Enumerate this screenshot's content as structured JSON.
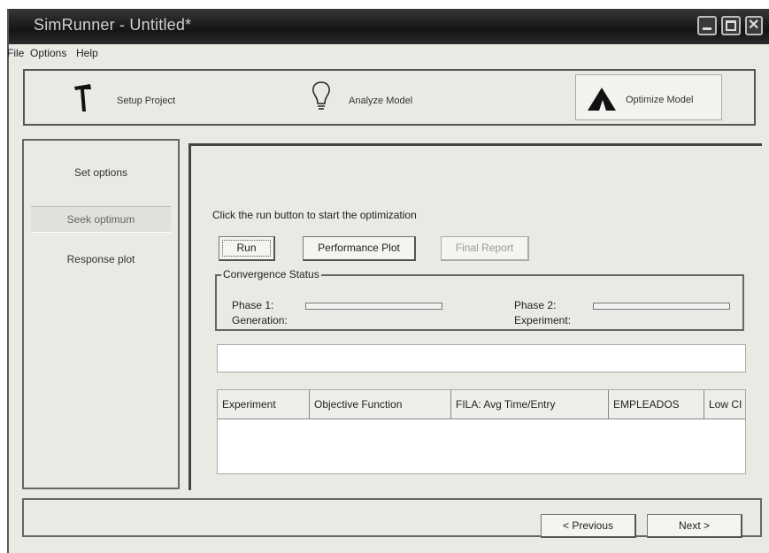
{
  "window": {
    "title": "SimRunner - Untitled*"
  },
  "menu": [
    "File",
    "Options",
    "Help"
  ],
  "wizard_steps": [
    {
      "label": "Setup Project",
      "icon": "hammer-icon"
    },
    {
      "label": "Analyze Model",
      "icon": "lightbulb-icon"
    },
    {
      "label": "Optimize Model",
      "icon": "mountain-icon",
      "active": true
    }
  ],
  "sidebar": {
    "items": [
      {
        "label": "Set options"
      },
      {
        "label": "Seek optimum",
        "selected": true
      },
      {
        "label": "Response plot"
      }
    ]
  },
  "main": {
    "instruction": "Click the run button to start the optimization",
    "buttons": {
      "run": "Run",
      "performance_plot": "Performance Plot",
      "final_report": "Final Report"
    },
    "convergence": {
      "title": "Convergence Status",
      "phase1_label": "Phase 1:",
      "phase1_progress": 0,
      "generation_label": "Generation:",
      "phase2_label": "Phase 2:",
      "phase2_progress": 0,
      "experiment_label": "Experiment:"
    },
    "status_text": "",
    "table": {
      "columns": [
        "Experiment",
        "Objective Function",
        "FILA: Avg Time/Entry",
        "EMPLEADOS",
        "Low CI"
      ],
      "rows": []
    }
  },
  "footer": {
    "previous": "< Previous",
    "next": "Next >"
  }
}
